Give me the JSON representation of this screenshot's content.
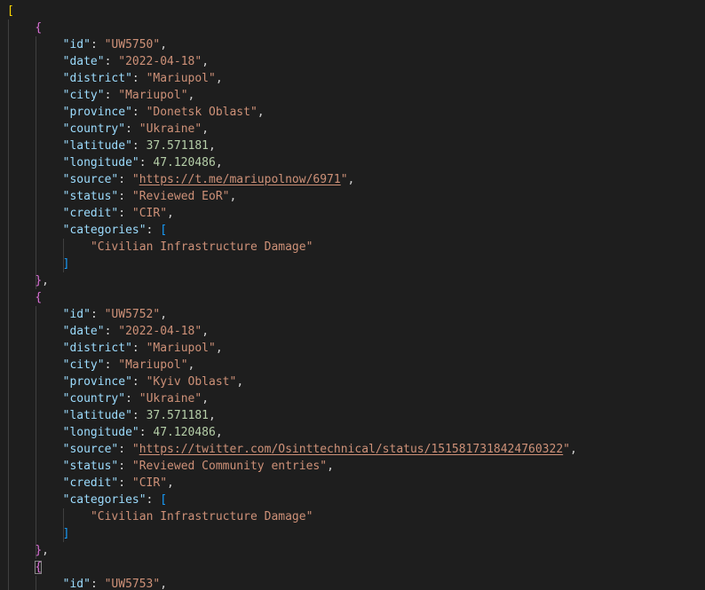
{
  "editor": {
    "language": "json",
    "theme": {
      "background": "#1e1e1e",
      "key_color": "#9cdcfe",
      "string_color": "#ce9178",
      "number_color": "#b5cea8",
      "punctuation_color": "#d4d4d4",
      "bracket_level1": "#ffd700",
      "bracket_level2": "#da70d6",
      "bracket_level3": "#179fff"
    },
    "records": [
      {
        "id": "UW5750",
        "date": "2022-04-18",
        "district": "Mariupol",
        "city": "Mariupol",
        "province": "Donetsk Oblast",
        "country": "Ukraine",
        "latitude": "37.571181",
        "longitude": "47.120486",
        "source": "https://t.me/mariupolnow/6971",
        "status": "Reviewed EoR",
        "credit": "CIR",
        "categories": [
          "Civilian Infrastructure Damage"
        ]
      },
      {
        "id": "UW5752",
        "date": "2022-04-18",
        "district": "Mariupol",
        "city": "Mariupol",
        "province": "Kyiv Oblast",
        "country": "Ukraine",
        "latitude": "37.571181",
        "longitude": "47.120486",
        "source": "https://twitter.com/Osinttechnical/status/1515817318424760322",
        "status": "Reviewed Community entries",
        "credit": "CIR",
        "categories": [
          "Civilian Infrastructure Damage"
        ]
      },
      {
        "id": "UW5753"
      }
    ]
  }
}
